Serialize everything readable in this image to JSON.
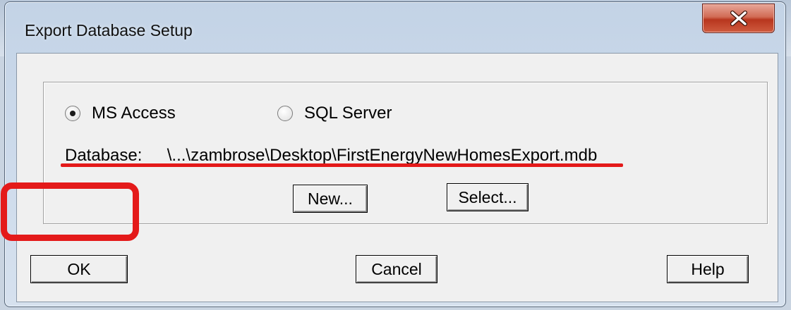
{
  "window": {
    "title": "Export Database Setup"
  },
  "options": {
    "ms_access": {
      "label": "MS Access",
      "selected": true
    },
    "sql_server": {
      "label": "SQL Server",
      "selected": false
    }
  },
  "database": {
    "label": "Database:",
    "path": "\\...\\zambrose\\Desktop\\FirstEnergyNewHomesExport.mdb"
  },
  "buttons": {
    "new": "New...",
    "select": "Select...",
    "ok": "OK",
    "cancel": "Cancel",
    "help": "Help"
  },
  "icons": {
    "close": "close-icon",
    "radio_selected": "radio-selected",
    "radio_unselected": "radio-unselected"
  },
  "colors": {
    "annotation_red": "#e41a1a",
    "dialog_face": "#f0f0f0",
    "close_red": "#c84a32"
  }
}
